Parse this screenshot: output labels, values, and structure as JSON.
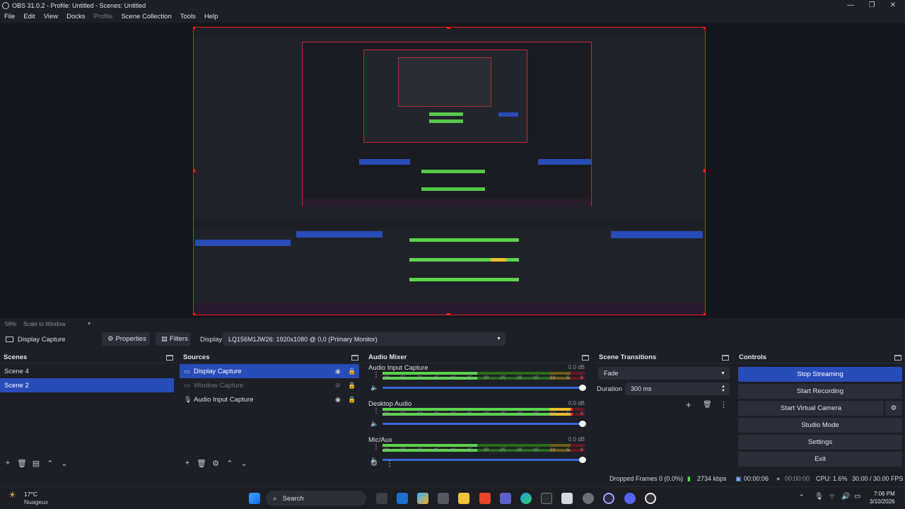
{
  "window": {
    "title": "OBS 31.0.2 - Profile: Untitled - Scenes: Untitled",
    "controls": [
      "—",
      "❐",
      "✕"
    ]
  },
  "menu": [
    "File",
    "Edit",
    "View",
    "Docks",
    "Profile",
    "Scene Collection",
    "Tools",
    "Help"
  ],
  "preview": {
    "zoom": "56%",
    "scale_mode": "Scale to Window"
  },
  "source_toolbar": {
    "source_name": "Display Capture",
    "properties_label": "Properties",
    "filters_label": "Filters",
    "display_label": "Display",
    "display_value": "LQ156M1JW26: 1920x1080 @ 0,0 (Primary Monitor)"
  },
  "scenes": {
    "title": "Scenes",
    "items": [
      {
        "label": "Scene 4",
        "selected": false
      },
      {
        "label": "Scene 2",
        "selected": true
      }
    ]
  },
  "sources": {
    "title": "Sources",
    "items": [
      {
        "label": "Display Capture",
        "icon": "monitor-icon",
        "selected": true,
        "visible": true
      },
      {
        "label": "Window Capture",
        "icon": "window-icon",
        "selected": false,
        "visible": false
      },
      {
        "label": "Audio Input Capture",
        "icon": "mic-icon",
        "selected": false,
        "visible": true
      }
    ]
  },
  "audio_mixer": {
    "title": "Audio Mixer",
    "channels": [
      {
        "name": "Audio Input Capture",
        "db": "0.0 dB",
        "level": 0.47
      },
      {
        "name": "Desktop Audio",
        "db": "0.0 dB",
        "level": 0.94
      },
      {
        "name": "Mic/Aux",
        "db": "0.0 dB",
        "level": 0.47
      }
    ],
    "ticks": [
      "-60",
      "-55",
      "-50",
      "-45",
      "-40",
      "-35",
      "-30",
      "-25",
      "-20",
      "-15",
      "-10",
      "-5",
      "0"
    ]
  },
  "transitions": {
    "title": "Scene Transitions",
    "transition": "Fade",
    "duration_label": "Duration",
    "duration_value": "300 ms"
  },
  "controls": {
    "title": "Controls",
    "buttons": [
      "Stop Streaming",
      "Start Recording",
      "Start Virtual Camera",
      "Studio Mode",
      "Settings",
      "Exit"
    ]
  },
  "status": {
    "dropped_frames": "Dropped Frames 0 (0.0%)",
    "bitrate": "2734 kbps",
    "stream_time": "00:00:06",
    "rec_time": "00:00:00",
    "cpu": "CPU: 1.6%",
    "fps": "30.00 / 30.00 FPS"
  },
  "taskbar": {
    "weather_temp": "17°C",
    "weather_desc": "Nuageux",
    "search_label": "Search",
    "time": "7:06 PM",
    "date": "3/10/2026"
  },
  "colors": {
    "accent": "#284cb8",
    "preview_border": "#e81c24",
    "meter_green": "#5cd34e",
    "meter_yellow": "#e8c12a",
    "meter_red": "#e23440"
  }
}
